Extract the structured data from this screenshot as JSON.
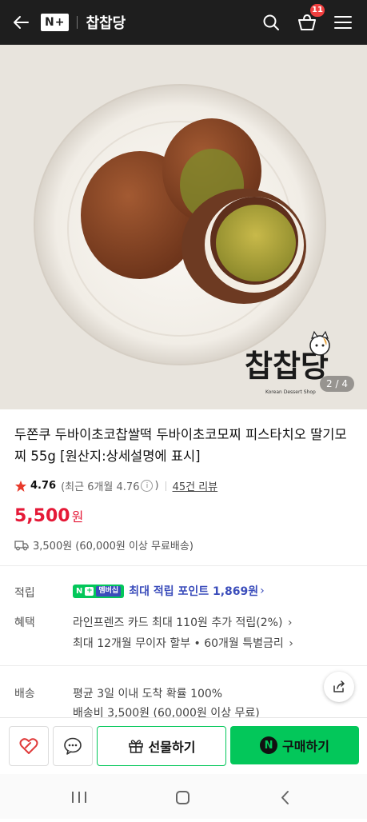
{
  "header": {
    "logo_text": "N+",
    "store_name": "찹찹당",
    "cart_count": "11"
  },
  "hero": {
    "image_counter": "2 / 4",
    "watermark_text": "찹찹당",
    "watermark_sub": "Korean Dessert Shop"
  },
  "product": {
    "title": "두쫀쿠 두바이초코찹쌀떡 두바이초코모찌 피스타치오 딸기모찌 55g [원산지:상세설명에 표시]",
    "rating_score": "4.76",
    "rating_recent": "(최근 6개월 4.76",
    "rating_recent_close": ")",
    "review_count": "45건 리뷰",
    "price": "5,500",
    "price_unit": "원",
    "shipping_summary": "3,500원 (60,000원 이상 무료배송)"
  },
  "points": {
    "label": "적립",
    "tag_n": "N",
    "tag_membership": "멤버십",
    "text": "최대 적립 포인트 1,869원"
  },
  "benefits": {
    "label": "혜택",
    "line1": "라인프렌즈 카드 최대 110원 추가 적립(2%)",
    "line2": "최대 12개월 무이자 할부 • 60개월 특별금리"
  },
  "delivery": {
    "label": "배송",
    "line1": "평균 3일 이내 도착 확률 100%",
    "line2": "배송비 3,500원 (60,000원 이상 무료)"
  },
  "bottom": {
    "gift_label": "선물하기",
    "buy_label": "구매하기",
    "buy_n": "N"
  },
  "colors": {
    "accent_green": "#03c75a",
    "price_red": "#e51937",
    "header_bg": "#1e1e1e"
  }
}
